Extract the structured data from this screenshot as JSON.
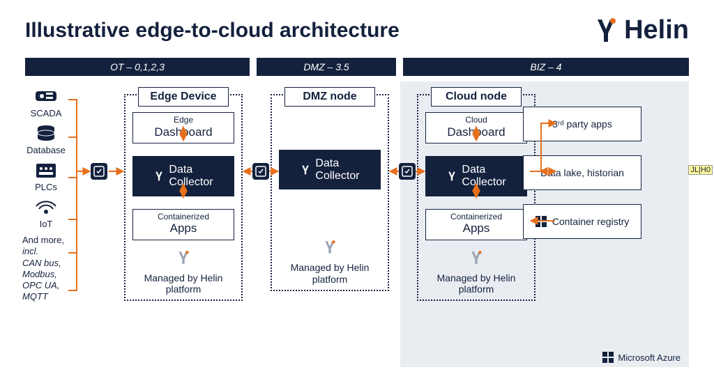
{
  "header": {
    "title": "Illustrative edge-to-cloud architecture",
    "brand": "Helin"
  },
  "zones": {
    "ot": "OT – 0,1,2,3",
    "dmz": "DMZ – 3.5",
    "biz": "BIZ – 4"
  },
  "sources": {
    "items": [
      {
        "label": "SCADA"
      },
      {
        "label": "Database"
      },
      {
        "label": "PLCs"
      },
      {
        "label": "IoT"
      }
    ],
    "more_line1": "And more,",
    "more_line2": "incl.",
    "more_line3": "CAN bus, Modbus, OPC UA, MQTT"
  },
  "nodes": {
    "edge": {
      "title": "Edge Device",
      "dashboard_small": "Edge",
      "dashboard_big": "Dashboard",
      "collector_title": "Data",
      "collector_sub": "Collector",
      "apps_small": "Containerized",
      "apps_big": "Apps",
      "managed": "Managed by Helin platform"
    },
    "dmz": {
      "title": "DMZ node",
      "collector_title": "Data",
      "collector_sub": "Collector",
      "managed": "Managed by Helin platform"
    },
    "cloud": {
      "title": "Cloud node",
      "dashboard_small": "Cloud",
      "dashboard_big": "Dashboard",
      "collector_title": "Data",
      "collector_sub": "Collector",
      "apps_small": "Containerized",
      "apps_big": "Apps",
      "managed": "Managed by Helin platform"
    }
  },
  "right": {
    "third_party": "3ʳᵈ party apps",
    "data_lake": "Data lake, historian",
    "registry": "Container registry"
  },
  "footer": {
    "azure": "Microsoft Azure"
  },
  "colors": {
    "navy": "#14213d",
    "orange": "#e76f1c",
    "grayblue": "#e9edf2"
  },
  "annotation": "JL|H0"
}
